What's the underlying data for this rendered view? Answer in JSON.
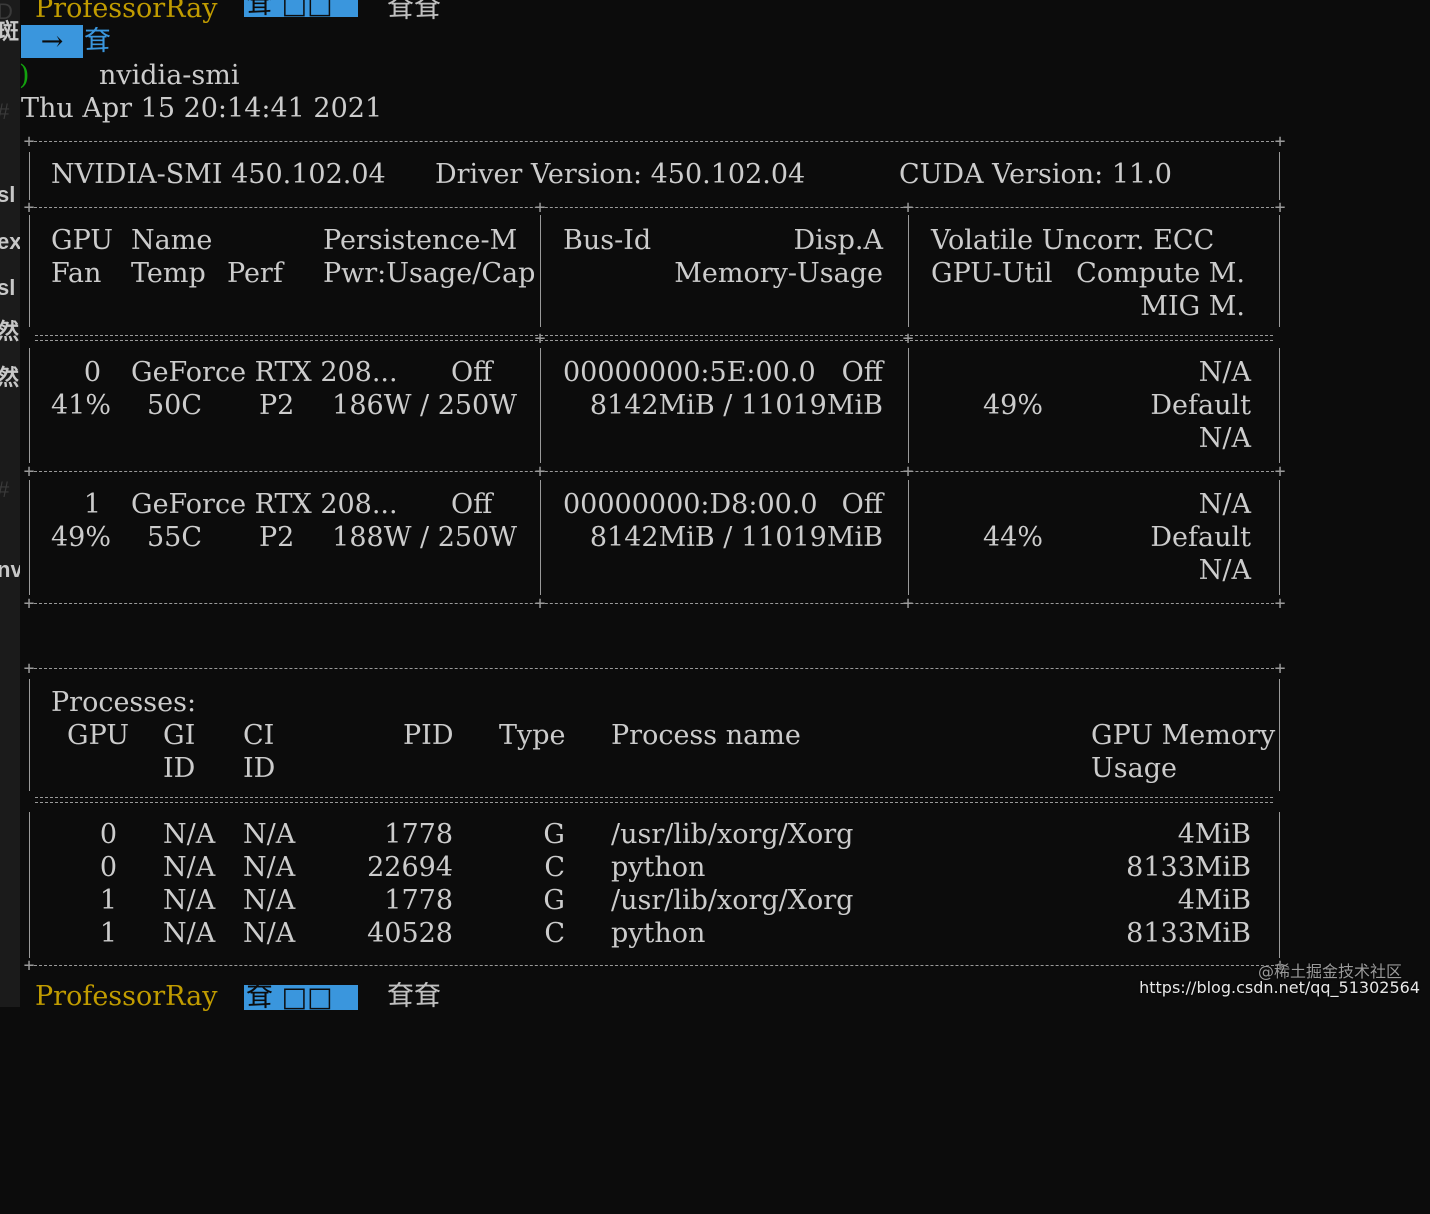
{
  "sidebar_glyphs": [
    {
      "text": "D",
      "dim": true
    },
    {
      "text": "斑",
      "dim": false
    },
    {
      "text": "#",
      "dim": true
    },
    {
      "text": "sl",
      "dim": false
    },
    {
      "text": "ex",
      "dim": false
    },
    {
      "text": "sl",
      "dim": false
    },
    {
      "text": "然",
      "dim": false
    },
    {
      "text": "然",
      "dim": false
    },
    {
      "text": "#",
      "dim": true
    },
    {
      "text": "nv",
      "dim": false
    }
  ],
  "prompt_top": {
    "user": "ProfessorRay",
    "branch_glyph": "耷 □□",
    "tail": "耷耷"
  },
  "prompt_arrow": {
    "arrow": "→",
    "glyph": "耷"
  },
  "command": {
    "prefix": ")",
    "text": "nvidia-smi"
  },
  "timestamp": "Thu Apr 15 20:14:41 2021",
  "header": {
    "smi": "NVIDIA-SMI 450.102.04",
    "driver": "Driver Version: 450.102.04",
    "cuda": "CUDA Version: 11.0"
  },
  "columns": {
    "c1_l1_gpu": "GPU",
    "c1_l1_name": "Name",
    "c1_l1_pers": "Persistence-M",
    "c1_l2_fan": "Fan",
    "c1_l2_temp": "Temp",
    "c1_l2_perf": "Perf",
    "c1_l2_pwr": "Pwr:Usage/Cap",
    "c2_l1_bus": "Bus-Id",
    "c2_l1_disp": "Disp.A",
    "c2_l2_mem": "Memory-Usage",
    "c3_l1": "Volatile Uncorr. ECC",
    "c3_l2_util": "GPU-Util",
    "c3_l2_comp": "Compute M.",
    "c3_l3_mig": "MIG M."
  },
  "gpus": [
    {
      "index": "0",
      "name": "GeForce RTX 208...",
      "persistence": "Off",
      "bus_id": "00000000:5E:00.0",
      "disp": "Off",
      "ecc": "N/A",
      "fan": "41%",
      "temp": "50C",
      "perf": "P2",
      "pwr": "186W / 250W",
      "mem": "8142MiB / 11019MiB",
      "util": "49%",
      "compute": "Default",
      "mig": "N/A"
    },
    {
      "index": "1",
      "name": "GeForce RTX 208...",
      "persistence": "Off",
      "bus_id": "00000000:D8:00.0",
      "disp": "Off",
      "ecc": "N/A",
      "fan": "49%",
      "temp": "55C",
      "perf": "P2",
      "pwr": "188W / 250W",
      "mem": "8142MiB / 11019MiB",
      "util": "44%",
      "compute": "Default",
      "mig": "N/A"
    }
  ],
  "processes": {
    "title": "Processes:",
    "h_gpu": "GPU",
    "h_gi": "GI",
    "h_gi2": "ID",
    "h_ci": "CI",
    "h_ci2": "ID",
    "h_pid": "PID",
    "h_type": "Type",
    "h_name": "Process name",
    "h_mem": "GPU Memory",
    "h_mem2": "Usage",
    "rows": [
      {
        "gpu": "0",
        "gi": "N/A",
        "ci": "N/A",
        "pid": "1778",
        "type": "G",
        "name": "/usr/lib/xorg/Xorg",
        "mem": "4MiB"
      },
      {
        "gpu": "0",
        "gi": "N/A",
        "ci": "N/A",
        "pid": "22694",
        "type": "C",
        "name": "python",
        "mem": "8133MiB"
      },
      {
        "gpu": "1",
        "gi": "N/A",
        "ci": "N/A",
        "pid": "1778",
        "type": "G",
        "name": "/usr/lib/xorg/Xorg",
        "mem": "4MiB"
      },
      {
        "gpu": "1",
        "gi": "N/A",
        "ci": "N/A",
        "pid": "40528",
        "type": "C",
        "name": "python",
        "mem": "8133MiB"
      }
    ]
  },
  "prompt_bottom": {
    "user": "ProfessorRay",
    "branch_glyph": "耷 □□",
    "tail": "耷耷"
  },
  "watermark": {
    "line1": "@稀土掘金技术社区",
    "line2": "https://blog.csdn.net/qq_51302564"
  },
  "colors": {
    "background": "#0c0c0c",
    "foreground": "#cccccc",
    "prompt_yellow": "#c19c00",
    "prompt_blue": "#3a96dd",
    "border": "#9a9a9a"
  }
}
